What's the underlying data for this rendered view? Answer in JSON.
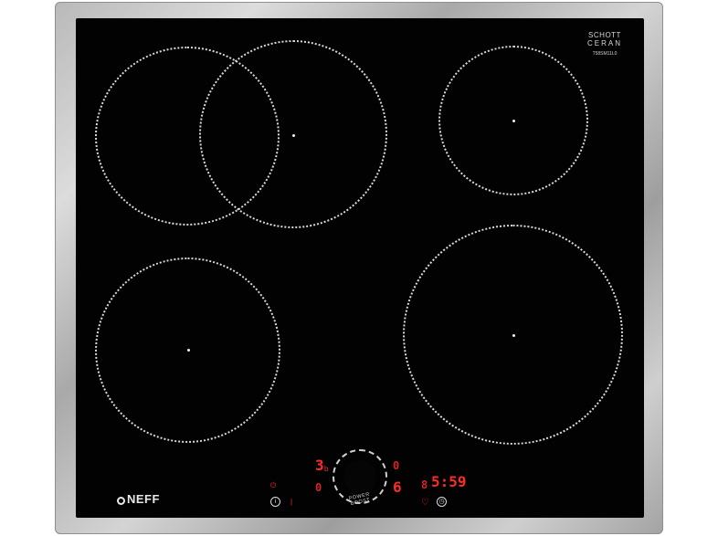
{
  "brand": {
    "manufacturer": "NEFF",
    "glass_line1": "SCHOTT",
    "glass_line2": "CERAN",
    "glass_line3": "T58SM11L0"
  },
  "display": {
    "left_level": "3",
    "left_level_small": "b",
    "left_zone_indicator": "0",
    "right_top_indicator": "0",
    "right_bottom_indicator": "6",
    "right_level": "6",
    "timer_zone": "8",
    "timer": "5:59"
  },
  "knob": {
    "label_line1": "POWER",
    "label_line2": "BOOST"
  },
  "icons": {
    "info": "info-icon",
    "timer": "clock-icon",
    "heart": "heart-icon",
    "power": "power-icon"
  },
  "colors": {
    "glass": "#020202",
    "frame": "#bdbdbd",
    "display_red": "#ff2a2a"
  }
}
